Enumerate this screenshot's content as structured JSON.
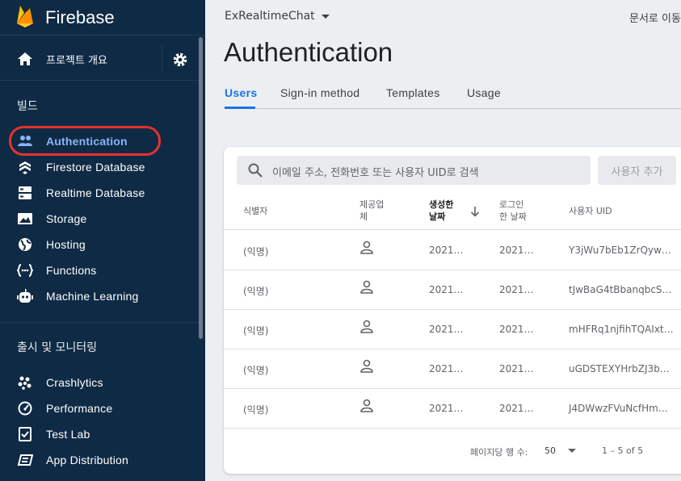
{
  "sidebar": {
    "brand": "Firebase",
    "overview_label": "프로젝트 개요",
    "sections": {
      "build_title": "빌드",
      "release_title": "출시 및 모니터링"
    },
    "build_items": [
      {
        "label": "Authentication",
        "icon": "people-icon",
        "active": true
      },
      {
        "label": "Firestore Database",
        "icon": "firestore-icon"
      },
      {
        "label": "Realtime Database",
        "icon": "database-icon"
      },
      {
        "label": "Storage",
        "icon": "image-icon"
      },
      {
        "label": "Hosting",
        "icon": "globe-icon"
      },
      {
        "label": "Functions",
        "icon": "functions-icon"
      },
      {
        "label": "Machine Learning",
        "icon": "robot-icon"
      }
    ],
    "release_items": [
      {
        "label": "Crashlytics",
        "icon": "crashlytics-icon"
      },
      {
        "label": "Performance",
        "icon": "speedometer-icon"
      },
      {
        "label": "Test Lab",
        "icon": "checklist-icon"
      },
      {
        "label": "App Distribution",
        "icon": "distribution-icon"
      }
    ]
  },
  "header": {
    "project": "ExRealtimeChat",
    "docs_link": "문서로 이동"
  },
  "page": {
    "title": "Authentication",
    "tabs": [
      "Users",
      "Sign-in method",
      "Templates",
      "Usage"
    ],
    "active_tab": "Users"
  },
  "users": {
    "search_placeholder": "이메일 주소, 전화번호 또는 사용자 UID로 검색",
    "add_user_label": "사용자 추가",
    "columns": {
      "identifier": "식별자",
      "provider": "제공업체",
      "created": "생성한 날짜",
      "signed_in": "로그인한 날짜",
      "uid": "사용자 UID"
    },
    "rows": [
      {
        "identifier": "(익명)",
        "created": "2021…",
        "signed_in": "2021…",
        "uid": "Y3jWu7bEb1ZrQyw…"
      },
      {
        "identifier": "(익명)",
        "created": "2021…",
        "signed_in": "2021…",
        "uid": "tJwBaG4tBbanqbcS…"
      },
      {
        "identifier": "(익명)",
        "created": "2021…",
        "signed_in": "2021…",
        "uid": "mHFRq1njfihTQAIxt…"
      },
      {
        "identifier": "(익명)",
        "created": "2021…",
        "signed_in": "2021…",
        "uid": "uGDSTEXYHrbZJ3b…"
      },
      {
        "identifier": "(익명)",
        "created": "2021…",
        "signed_in": "2021…",
        "uid": "J4DWwzFVuNcfHm…"
      }
    ],
    "pagination": {
      "rows_per_page_label": "페이지당 행 수:",
      "rows_per_page": "50",
      "range": "1 – 5 of 5"
    }
  },
  "colors": {
    "sidebar_bg": "#0f2a45",
    "accent": "#1a73e8",
    "active_nav": "#8ab4f8",
    "highlight_ring": "#e5322d"
  }
}
